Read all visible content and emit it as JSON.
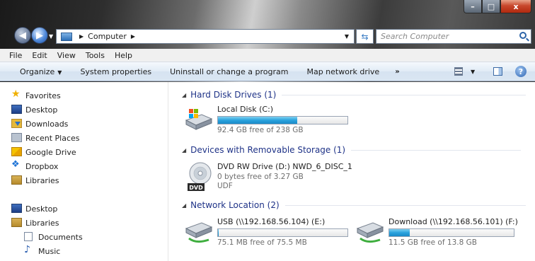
{
  "window": {
    "minimize": "–",
    "maximize": "□",
    "close": "x"
  },
  "address": {
    "crumbs": [
      "Computer"
    ]
  },
  "search": {
    "placeholder": "Search Computer"
  },
  "menu": [
    "File",
    "Edit",
    "View",
    "Tools",
    "Help"
  ],
  "commands": {
    "organize": "Organize",
    "system_properties": "System properties",
    "uninstall": "Uninstall or change a program",
    "map_drive": "Map network drive",
    "more": "»"
  },
  "nav": {
    "favorites": "Favorites",
    "desktop": "Desktop",
    "downloads": "Downloads",
    "recent": "Recent Places",
    "gdrive": "Google Drive",
    "dropbox": "Dropbox",
    "libraries": "Libraries",
    "desktop2": "Desktop",
    "libraries2": "Libraries",
    "documents": "Documents",
    "music": "Music"
  },
  "groups": {
    "hdd": "Hard Disk Drives (1)",
    "removable": "Devices with Removable Storage (1)",
    "network": "Network Location (2)"
  },
  "drives": {
    "c": {
      "name": "Local Disk (C:)",
      "free": "92.4 GB free of 238 GB",
      "used_fraction": 0.612
    },
    "d": {
      "name": "DVD RW Drive (D:) NWD_6_DISC_1",
      "free": "0 bytes free of 3.27 GB",
      "fs": "UDF",
      "badge": "DVD"
    },
    "e": {
      "name": "USB (\\\\192.168.56.104) (E:)",
      "free": "75.1 MB free of 75.5 MB",
      "used_fraction": 0.005
    },
    "f": {
      "name": "Download (\\\\192.168.56.101) (F:)",
      "free": "11.5 GB free of 13.8 GB",
      "used_fraction": 0.167
    }
  },
  "colors": {
    "accent": "#1e3287",
    "bar_fill": "#2aa3dd"
  }
}
